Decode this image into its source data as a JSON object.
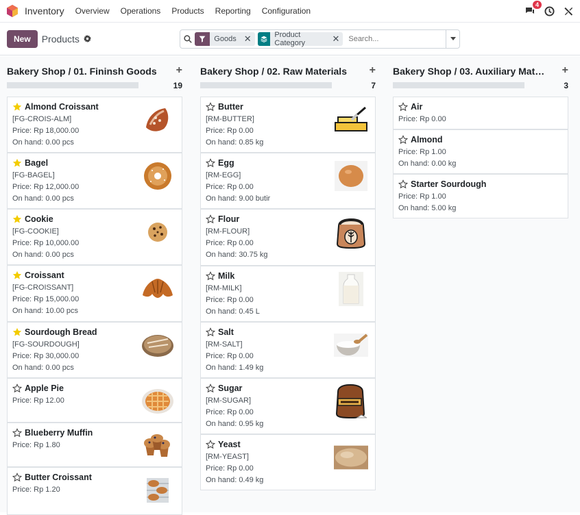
{
  "navbar": {
    "app_name": "Inventory",
    "menu": [
      "Overview",
      "Operations",
      "Products",
      "Reporting",
      "Configuration"
    ],
    "chat_count": "4"
  },
  "control": {
    "new_label": "New",
    "breadcrumb": "Products",
    "facets": [
      {
        "label": "Goods",
        "color": "#714b67"
      },
      {
        "label": "Product Category",
        "color": "#017e84"
      }
    ],
    "search_placeholder": "Search..."
  },
  "columns": [
    {
      "title": "Bakery Shop / 01. Fininsh Goods",
      "count": "19",
      "cards": [
        {
          "name": "Almond Croissant",
          "ref": "[FG-CROIS-ALM]",
          "price": "Price: Rp 18,000.00",
          "onhand": "On hand: 0.00 pcs",
          "starred": true,
          "icon": "almond-croissant-image"
        },
        {
          "name": "Bagel",
          "ref": "[FG-BAGEL]",
          "price": "Price: Rp 12,000.00",
          "onhand": "On hand: 0.00 pcs",
          "starred": true,
          "icon": "bagel-image"
        },
        {
          "name": "Cookie",
          "ref": "[FG-COOKIE]",
          "price": "Price: Rp 10,000.00",
          "onhand": "On hand: 0.00 pcs",
          "starred": true,
          "icon": "cookie-image"
        },
        {
          "name": "Croissant",
          "ref": "[FG-CROISSANT]",
          "price": "Price: Rp 15,000.00",
          "onhand": "On hand: 10.00 pcs",
          "starred": true,
          "icon": "croissant-image"
        },
        {
          "name": "Sourdough Bread",
          "ref": "[FG-SOURDOUGH]",
          "price": "Price: Rp 30,000.00",
          "onhand": "On hand: 0.00 pcs",
          "starred": true,
          "icon": "sourdough-bread-image"
        },
        {
          "name": "Apple Pie",
          "price": "Price: Rp 12.00",
          "starred": false,
          "icon": "apple-pie-image"
        },
        {
          "name": "Blueberry Muffin",
          "price": "Price: Rp 1.80",
          "starred": false,
          "icon": "blueberry-muffin-image"
        },
        {
          "name": "Butter Croissant",
          "price": "Price: Rp 1.20",
          "starred": false,
          "icon": "butter-croissant-image"
        }
      ]
    },
    {
      "title": "Bakery Shop / 02. Raw Materials",
      "count": "7",
      "cards": [
        {
          "name": "Butter",
          "ref": "[RM-BUTTER]",
          "price": "Price: Rp 0.00",
          "onhand": "On hand: 0.85 kg",
          "starred": false,
          "icon": "butter-image"
        },
        {
          "name": "Egg",
          "ref": "[RM-EGG]",
          "price": "Price: Rp 0.00",
          "onhand": "On hand: 9.00 butir",
          "starred": false,
          "icon": "egg-image"
        },
        {
          "name": "Flour",
          "ref": "[RM-FLOUR]",
          "price": "Price: Rp 0.00",
          "onhand": "On hand: 30.75 kg",
          "starred": false,
          "icon": "flour-sack-image"
        },
        {
          "name": "Milk",
          "ref": "[RM-MILK]",
          "price": "Price: Rp 0.00",
          "onhand": "On hand: 0.45 L",
          "starred": false,
          "icon": "milk-bottle-image"
        },
        {
          "name": "Salt",
          "ref": "[RM-SALT]",
          "price": "Price: Rp 0.00",
          "onhand": "On hand: 1.49 kg",
          "starred": false,
          "icon": "salt-bowl-image"
        },
        {
          "name": "Sugar",
          "ref": "[RM-SUGAR]",
          "price": "Price: Rp 0.00",
          "onhand": "On hand: 0.95 kg",
          "starred": false,
          "icon": "sugar-sack-image"
        },
        {
          "name": "Yeast",
          "ref": "[RM-YEAST]",
          "price": "Price: Rp 0.00",
          "onhand": "On hand: 0.49 kg",
          "starred": false,
          "icon": "yeast-image"
        }
      ]
    },
    {
      "title": "Bakery Shop / 03. Auxiliary Mate...",
      "count": "3",
      "cards": [
        {
          "name": "Air",
          "price": "Price: Rp 0.00",
          "starred": false
        },
        {
          "name": "Almond",
          "price": "Price: Rp 1.00",
          "onhand": "On hand: 0.00 kg",
          "starred": false
        },
        {
          "name": "Starter Sourdough",
          "price": "Price: Rp 1.00",
          "onhand": "On hand: 5.00 kg",
          "starred": false
        }
      ]
    }
  ]
}
